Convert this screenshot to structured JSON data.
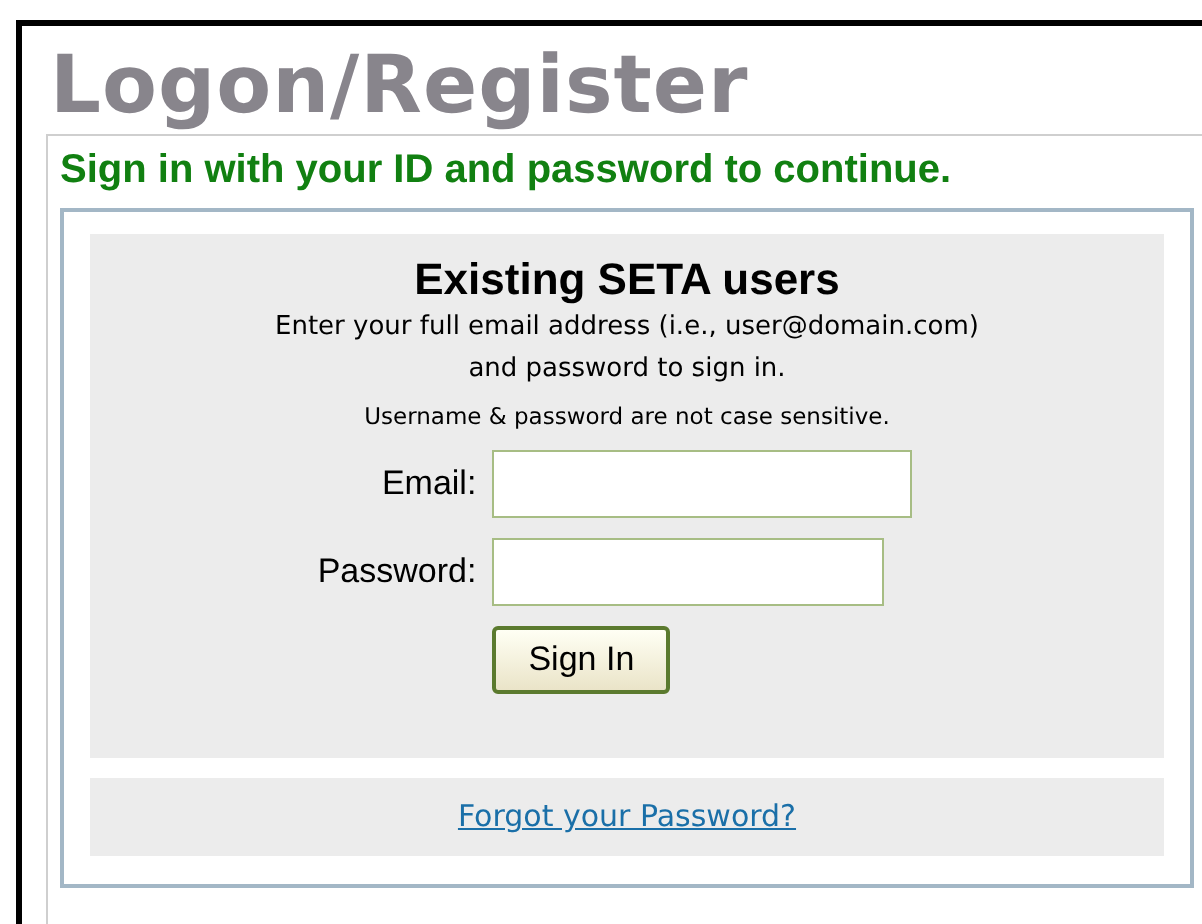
{
  "title": "Logon/Register",
  "subtitle": "Sign in with your ID and password to continue.",
  "login": {
    "heading": "Existing SETA users",
    "instructions": [
      "Enter your full email address (i.e., user@domain.com)",
      "and password to sign in."
    ],
    "note": "Username & password are not case sensitive.",
    "fields": [
      {
        "label": "Email:",
        "kind": "text"
      },
      {
        "label": "Password:",
        "kind": "password"
      }
    ],
    "button": "Sign In"
  },
  "forgot_link": "Forgot your Password?"
}
